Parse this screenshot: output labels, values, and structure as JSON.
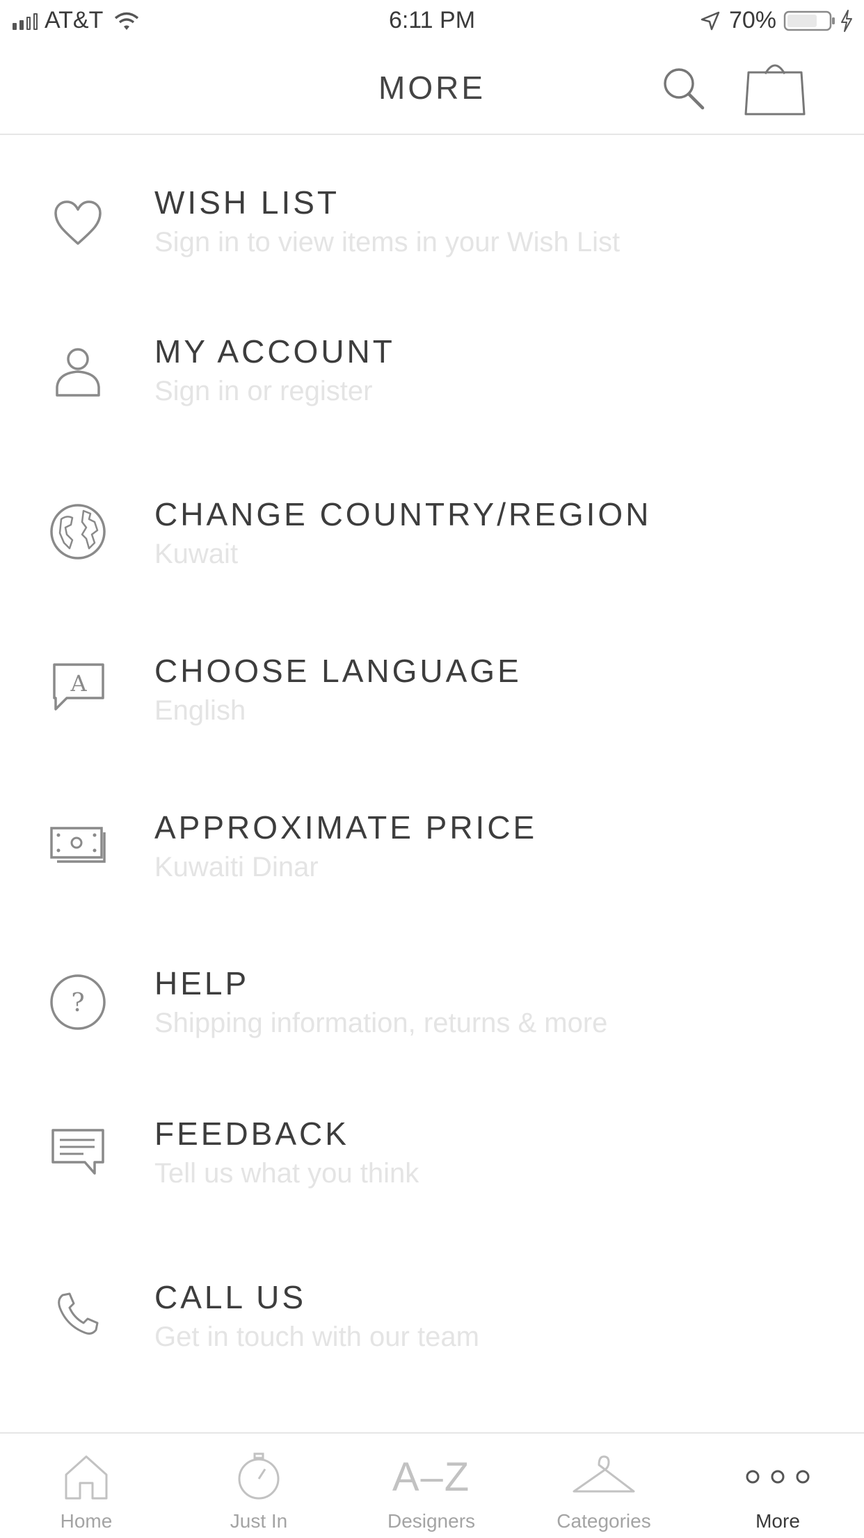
{
  "status_bar": {
    "carrier": "AT&T",
    "time": "6:11 PM",
    "battery": "70%"
  },
  "header": {
    "title": "MORE",
    "search_icon": "search-icon",
    "bag_icon": "shopping-bag-icon"
  },
  "menu": [
    {
      "icon": "heart-icon",
      "label": "WISH LIST",
      "subtitle": "Sign in to view items in your Wish List"
    },
    {
      "icon": "person-icon",
      "label": "MY ACCOUNT",
      "subtitle": "Sign in or register"
    },
    {
      "icon": "globe-icon",
      "label": "CHANGE COUNTRY/REGION",
      "subtitle": "Kuwait"
    },
    {
      "icon": "language-icon",
      "label": "CHOOSE LANGUAGE",
      "subtitle": "English"
    },
    {
      "icon": "money-icon",
      "label": "APPROXIMATE PRICE",
      "subtitle": "Kuwaiti Dinar"
    },
    {
      "icon": "help-icon",
      "label": "HELP",
      "subtitle": "Shipping information, returns & more"
    },
    {
      "icon": "feedback-icon",
      "label": "FEEDBACK",
      "subtitle": "Tell us what you think"
    },
    {
      "icon": "phone-icon",
      "label": "CALL US",
      "subtitle": "Get in touch with our team"
    }
  ],
  "tabs": [
    {
      "icon": "home-icon",
      "label": "Home"
    },
    {
      "icon": "stopwatch-icon",
      "label": "Just In"
    },
    {
      "icon": "a-z-icon",
      "label": "Designers",
      "glyph": "A–Z"
    },
    {
      "icon": "hanger-icon",
      "label": "Categories"
    },
    {
      "icon": "more-dots-icon",
      "label": "More",
      "active": true
    }
  ],
  "colors": {
    "text": "#3a3a3a",
    "subtitle": "#e4e4e4",
    "icon": "#8a8a8a",
    "tab_inactive": "#a4a4a4"
  }
}
